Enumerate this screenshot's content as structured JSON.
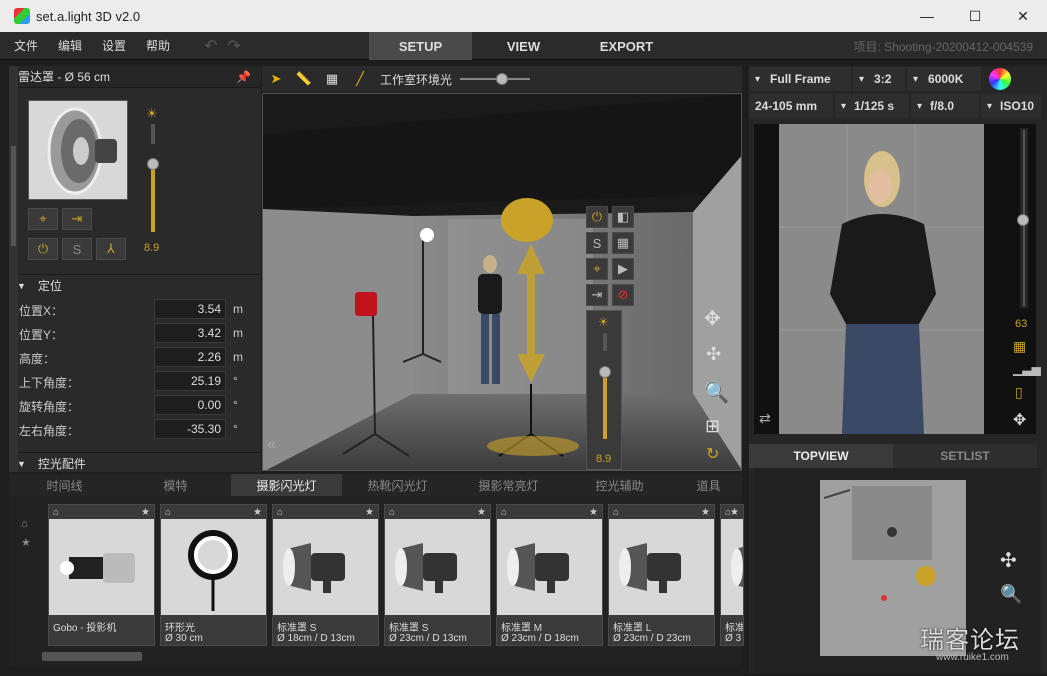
{
  "window": {
    "title": "set.a.light 3D v2.0",
    "minimize": "—",
    "maximize": "☐",
    "close": "✕"
  },
  "menu": {
    "items": [
      "文件",
      "编辑",
      "设置",
      "帮助"
    ],
    "undo": "↶",
    "redo": "↷"
  },
  "modes": {
    "tabs": [
      "SETUP",
      "VIEW",
      "EXPORT"
    ],
    "active": "SETUP"
  },
  "project": "项目: Shooting-20200412-004539",
  "light": {
    "name": "雷达罩 - Ø 56 cm",
    "power_value": "8.9",
    "power_level": 0.63,
    "buttons": {
      "power": "⏻",
      "s": "S",
      "y": "⅄"
    }
  },
  "position": {
    "section_title": "定位",
    "rows": [
      {
        "label": "位置X：",
        "value": "3.54",
        "unit": "m"
      },
      {
        "label": "位置Y：",
        "value": "3.42",
        "unit": "m"
      },
      {
        "label": "高度：",
        "value": "2.26",
        "unit": "m"
      },
      {
        "label": "上下角度：",
        "value": "25.19",
        "unit": "°"
      },
      {
        "label": "旋转角度：",
        "value": "0.00",
        "unit": "°"
      },
      {
        "label": "左右角度：",
        "value": "-35.30",
        "unit": "°"
      }
    ]
  },
  "accessories": {
    "section_title": "控光配件"
  },
  "viewport_toolbar": {
    "ambient_label": "工作室环境光",
    "ambient_level": 0.6
  },
  "viewport": {
    "power_value": "8.9",
    "collapse": "«"
  },
  "bottom_tabs": {
    "items": [
      "时间线",
      "模特",
      "摄影闪光灯",
      "热靴闪光灯",
      "摄影常亮灯",
      "控光辅助",
      "道具"
    ],
    "active": "摄影闪光灯"
  },
  "library": {
    "cards": [
      {
        "name": "Gobo - 投影机",
        "size": ""
      },
      {
        "name": "环形光",
        "size": "Ø 30 cm"
      },
      {
        "name": "标准罩 S",
        "size": "Ø 18cm / D 13cm"
      },
      {
        "name": "标准罩 S",
        "size": "Ø 23cm / D 13cm"
      },
      {
        "name": "标准罩 M",
        "size": "Ø 23cm / D 18cm"
      },
      {
        "name": "标准罩 L",
        "size": "Ø 23cm / D 23cm"
      },
      {
        "name": "标准",
        "size": "Ø 3"
      }
    ]
  },
  "camera": {
    "sensor": "Full Frame",
    "ratio": "3:2",
    "wb": "6000K",
    "lens": "24-105 mm",
    "shutter": "1/125 s",
    "aperture": "f/8.0",
    "iso": "ISO10",
    "focal_value": "63",
    "dropdown": "▾"
  },
  "right_tabs": {
    "items": [
      "TOPVIEW",
      "SETLIST"
    ],
    "active": "TOPVIEW"
  },
  "watermark": {
    "text": "瑞客论坛",
    "url": "www.ruike1.com"
  },
  "colors": {
    "accent": "#c9a227",
    "panel": "#2a2a2a",
    "bg": "#1e1e1e"
  }
}
